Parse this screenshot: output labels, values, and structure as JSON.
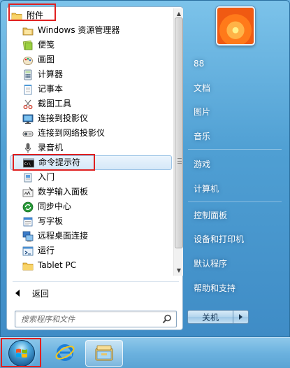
{
  "programs": {
    "folder_label": "附件",
    "items": [
      {
        "label": "Windows 资源管理器",
        "icon": "windows-explorer-icon"
      },
      {
        "label": "便笺",
        "icon": "sticky-notes-icon"
      },
      {
        "label": "画图",
        "icon": "paint-icon"
      },
      {
        "label": "计算器",
        "icon": "calculator-icon"
      },
      {
        "label": "记事本",
        "icon": "notepad-icon"
      },
      {
        "label": "截图工具",
        "icon": "snipping-tool-icon"
      },
      {
        "label": "连接到投影仪",
        "icon": "projector-icon"
      },
      {
        "label": "连接到网络投影仪",
        "icon": "network-projector-icon"
      },
      {
        "label": "录音机",
        "icon": "sound-recorder-icon"
      },
      {
        "label": "命令提示符",
        "icon": "command-prompt-icon"
      },
      {
        "label": "入门",
        "icon": "getting-started-icon"
      },
      {
        "label": "数学输入面板",
        "icon": "math-input-icon"
      },
      {
        "label": "同步中心",
        "icon": "sync-center-icon"
      },
      {
        "label": "写字板",
        "icon": "wordpad-icon"
      },
      {
        "label": "远程桌面连接",
        "icon": "remote-desktop-icon"
      },
      {
        "label": "运行",
        "icon": "run-icon"
      },
      {
        "label": "Tablet PC",
        "icon": "folder-icon"
      }
    ]
  },
  "back_label": "返回",
  "search": {
    "placeholder": "搜索程序和文件"
  },
  "right_pane": {
    "user_name": "88",
    "items": [
      "文档",
      "图片",
      "音乐",
      "游戏",
      "计算机",
      "控制面板",
      "设备和打印机",
      "默认程序",
      "帮助和支持"
    ]
  },
  "shutdown_label": "关机",
  "colors": {
    "highlight_border": "#e02020",
    "taskbar": "#6cb2df",
    "menu_glass": "#4f9fd3"
  }
}
